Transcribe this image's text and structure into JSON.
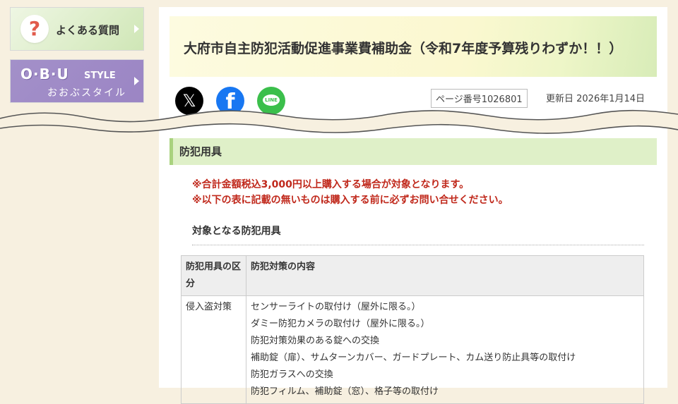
{
  "sidebar": {
    "faq": {
      "icon": "question-icon",
      "label": "よくある質問"
    },
    "obu": {
      "title": "O·B·U",
      "sub": "STYLE",
      "kana": "おおぶスタイル"
    }
  },
  "page": {
    "title": "大府市自主防犯活動促進事業費補助金（令和7年度予算残りわずか！！）",
    "social": {
      "x": "𝕏",
      "facebook": "f",
      "line": "LINE"
    },
    "page_number": "ページ番号1026801",
    "updated": "更新日  2026年1月14日"
  },
  "section": {
    "heading": "防犯用具",
    "notes": [
      "※合計金額税込3,000円以上購入する場合が対象となります。",
      "※以下の表に記載の無いものは購入する前に必ずお問い合せください。"
    ],
    "subheading": "対象となる防犯用具"
  },
  "table": {
    "headers": [
      "防犯用具の区分",
      "防犯対策の内容"
    ],
    "rows": [
      {
        "category": "侵入盗対策",
        "items": [
          "センサーライトの取付け（屋外に限る。）",
          "ダミー防犯カメラの取付け（屋外に限る。）",
          "防犯対策効果のある錠への交換",
          "補助錠（扉）、サムターンカバー、ガードプレート、カム送り防止具等の取付け",
          "防犯ガラスへの交換",
          "防犯フィルム、補助錠（窓）、格子等の取付け"
        ]
      }
    ]
  },
  "colors": {
    "notice_red": "#c0281b",
    "section_green": "#dff0c8",
    "background": "#f7f0e0"
  }
}
